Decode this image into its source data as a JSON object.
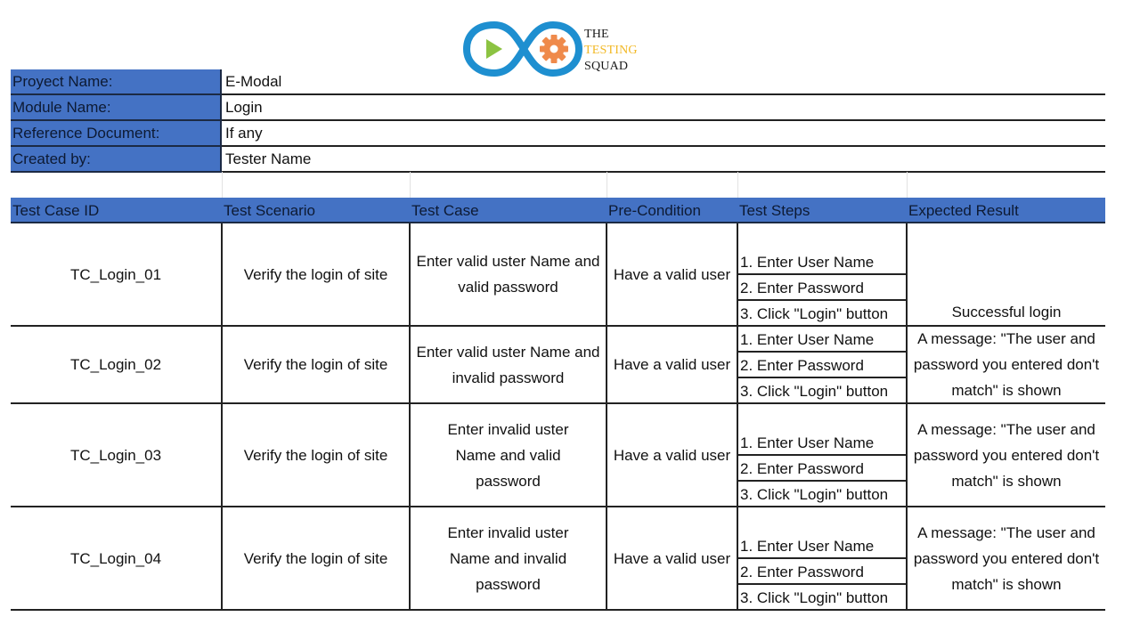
{
  "logo": {
    "line1": "THE",
    "line2": "TESTING",
    "line3": "SQUAD",
    "colors": {
      "ring": "#1e8fd0",
      "play": "#8cc342",
      "gear": "#ef8a4b",
      "testing_text": "#f2b824"
    }
  },
  "info": [
    {
      "label": "Proyect Name:",
      "value": "E-Modal"
    },
    {
      "label": "Module Name:",
      "value": "Login"
    },
    {
      "label": "Reference Document:",
      "value": "If any"
    },
    {
      "label": "Created by:",
      "value": "Tester Name"
    }
  ],
  "table": {
    "header_color": "#4472c4",
    "columns": [
      "Test Case ID",
      "Test Scenario",
      "Test Case",
      "Pre-Condition",
      "Test Steps",
      "Expected Result"
    ],
    "rows": [
      {
        "id": "TC_Login_01",
        "scenario": "Verify the login of site",
        "test_case": "Enter valid uster Name and valid password",
        "precondition": "Have a valid user",
        "steps": [
          "1. Enter User Name",
          "2. Enter Password",
          "3. Click \"Login\" button"
        ],
        "expected": "Successful login"
      },
      {
        "id": "TC_Login_02",
        "scenario": "Verify the login of site",
        "test_case": "Enter valid uster Name and invalid password",
        "precondition": "Have a valid user",
        "steps": [
          "1. Enter User Name",
          "2. Enter Password",
          "3. Click \"Login\" button"
        ],
        "expected": "A message: \"The user and password you entered don't match\" is shown"
      },
      {
        "id": "TC_Login_03",
        "scenario": "Verify the login of site",
        "test_case": "Enter invalid uster Name and valid password",
        "precondition": "Have a valid user",
        "steps": [
          "1. Enter User Name",
          "2. Enter Password",
          "3. Click \"Login\" button"
        ],
        "expected": "A message: \"The user and password you entered don't match\" is shown"
      },
      {
        "id": "TC_Login_04",
        "scenario": "Verify the login of site",
        "test_case": "Enter invalid uster Name and invalid password",
        "precondition": "Have a valid user",
        "steps": [
          "1. Enter User Name",
          "2. Enter Password",
          "3. Click \"Login\" button"
        ],
        "expected": "A message: \"The user and password you entered don't match\" is shown"
      }
    ]
  }
}
